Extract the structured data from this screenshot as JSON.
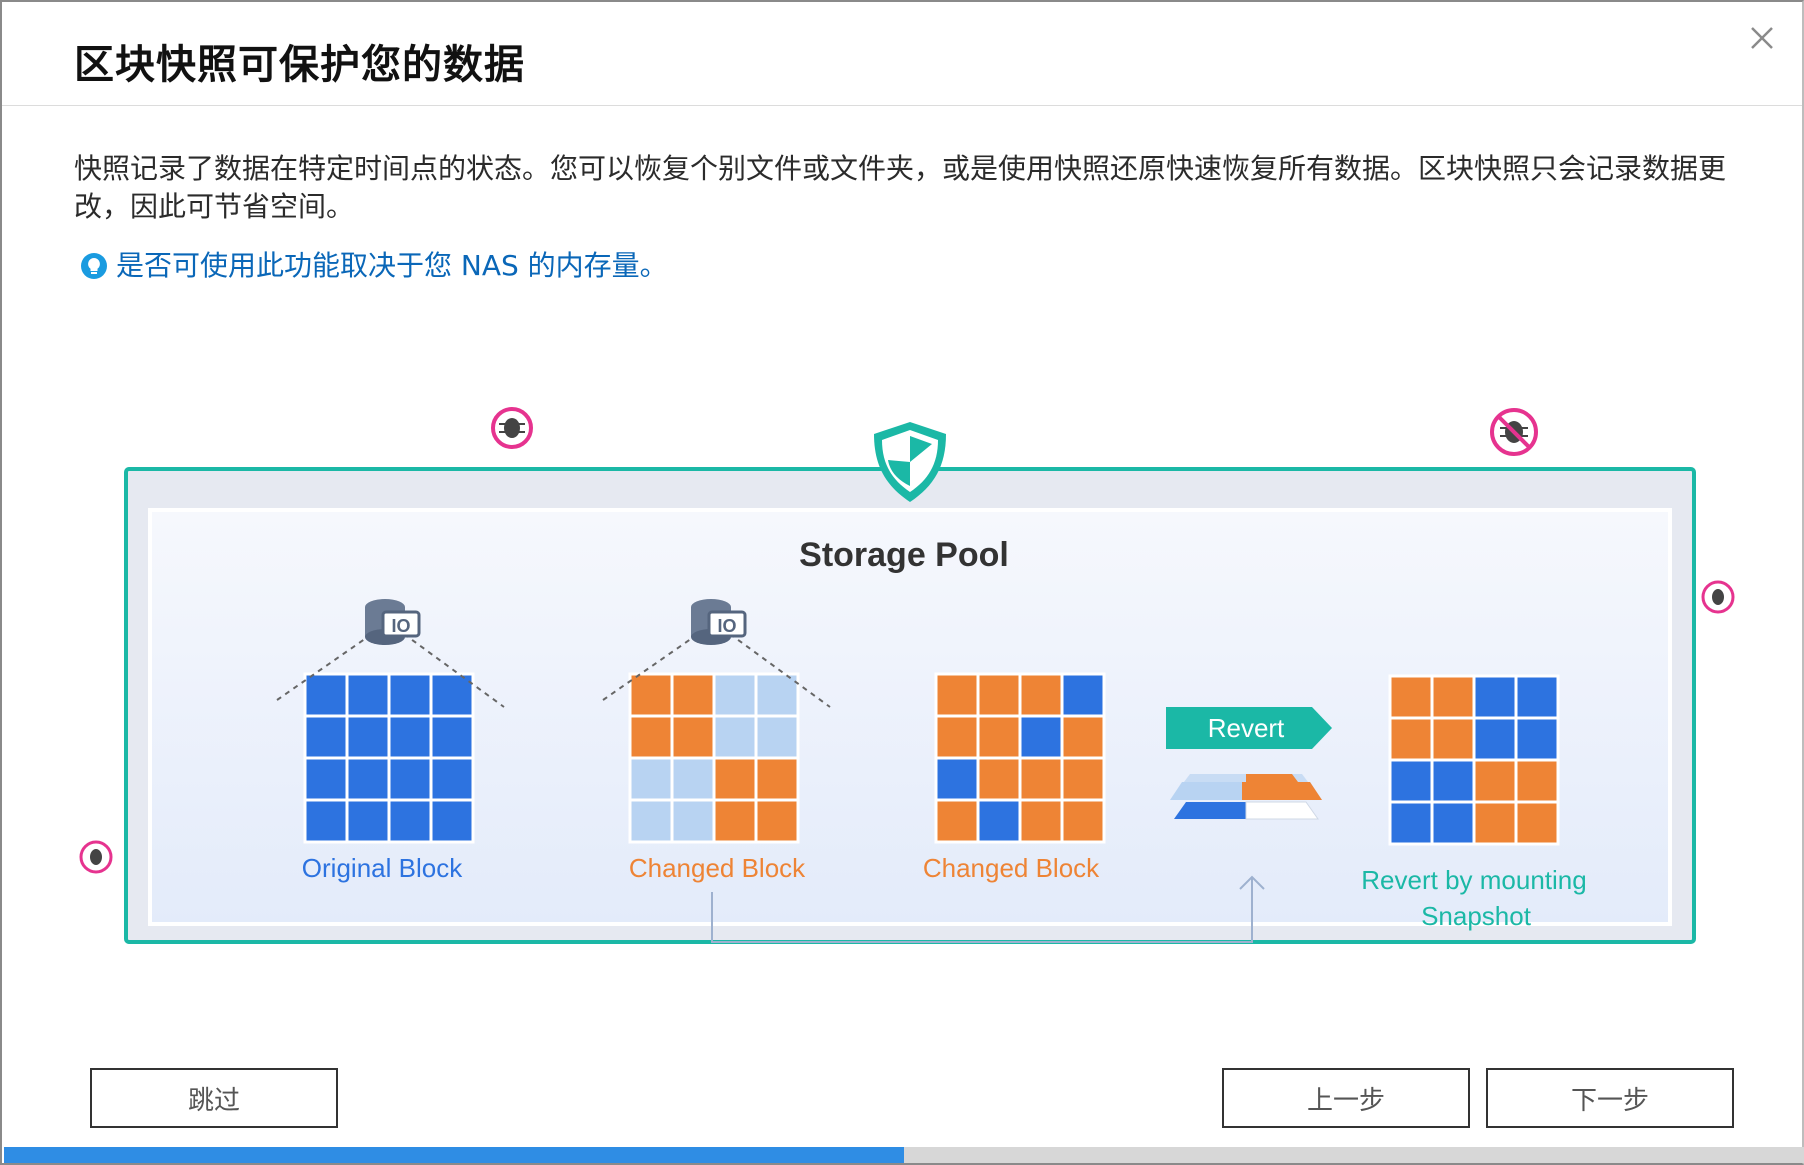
{
  "dialog": {
    "title": "区块快照可保护您的数据",
    "description": "快照记录了数据在特定时间点的状态。您可以恢复个别文件或文件夹，或是使用快照还原快速恢复所有数据。区块快照只会记录数据更改，因此可节省空间。",
    "tip": "是否可使用此功能取决于您 NAS 的内存量。",
    "close_icon": "close-icon",
    "tip_icon": "lightbulb-icon"
  },
  "illustration": {
    "pool_title": "Storage Pool",
    "original_label": "Original Block",
    "changed_label_1": "Changed Block",
    "changed_label_2": "Changed Block",
    "revert_label": "Revert",
    "mount_label_line1": "Revert by mounting",
    "mount_label_line2": "Snapshot",
    "camera_label_1": "IO",
    "camera_label_2": "IO",
    "colors": {
      "teal": "#1bb8a6",
      "blue": "#2d73e0",
      "orange": "#ee8435",
      "light_blue": "#b8d3f2",
      "virus": "#e6338f"
    }
  },
  "buttons": {
    "skip": "跳过",
    "previous": "上一步",
    "next": "下一步"
  },
  "progress": {
    "fraction": 0.5
  }
}
